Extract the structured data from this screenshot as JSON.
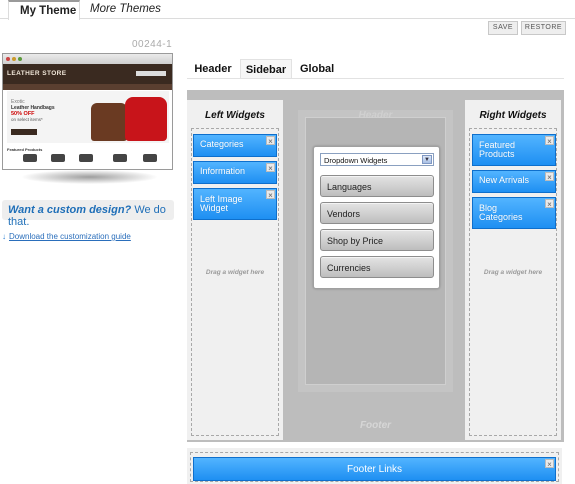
{
  "tabs": {
    "active": "My Theme",
    "other": "More Themes"
  },
  "actions": {
    "save": "SAVE",
    "restore": "RESTORE"
  },
  "theme": {
    "code": "00244-1",
    "preview": {
      "logo": "LEATHER STORE",
      "banner_line1": "Exotic",
      "banner_line2": "Leather Handbags",
      "banner_line3": "50% OFF",
      "banner_line4": "on select items*",
      "featured": "Featured Products"
    }
  },
  "promo": {
    "question": "Want a custom design?",
    "answer": "We do that."
  },
  "guide_link": "Download the customization guide",
  "layout_tabs": [
    "Header",
    "Sidebar",
    "Global"
  ],
  "canvas": {
    "header": "Header",
    "footer": "Footer"
  },
  "left_column": {
    "title": "Left Widgets",
    "widgets": [
      "Categories",
      "Information",
      "Left Image Widget"
    ],
    "hint": "Drag a widget here"
  },
  "right_column": {
    "title": "Right Widgets",
    "widgets": [
      "Featured Products",
      "New Arrivals",
      "Blog Categories"
    ],
    "hint": "Drag a widget here"
  },
  "dropdown": {
    "selected": "Dropdown Widgets",
    "options": [
      "Languages",
      "Vendors",
      "Shop by Price",
      "Currencies"
    ]
  },
  "footer_widget": "Footer Links",
  "close_glyph": "×",
  "colors": {
    "widget_blue": "#1e8ff2",
    "link_blue": "#2a6ebb"
  }
}
